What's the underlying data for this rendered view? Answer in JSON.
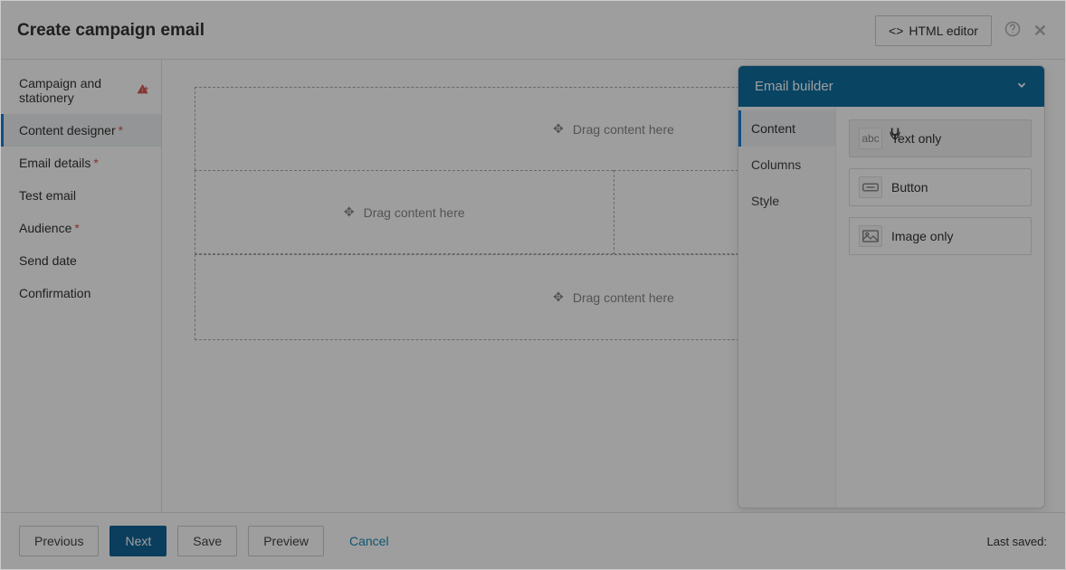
{
  "header": {
    "title": "Create campaign email",
    "html_editor_label": "HTML editor"
  },
  "sidebar": {
    "items": [
      {
        "label": "Campaign and stationery",
        "required": true,
        "warning": true,
        "active": false
      },
      {
        "label": "Content designer",
        "required": true,
        "warning": false,
        "active": true
      },
      {
        "label": "Email details",
        "required": true,
        "warning": false,
        "active": false
      },
      {
        "label": "Test email",
        "required": false,
        "warning": false,
        "active": false
      },
      {
        "label": "Audience",
        "required": true,
        "warning": false,
        "active": false
      },
      {
        "label": "Send date",
        "required": false,
        "warning": false,
        "active": false
      },
      {
        "label": "Confirmation",
        "required": false,
        "warning": false,
        "active": false
      }
    ]
  },
  "canvas": {
    "drop_label": "Drag content here"
  },
  "builder": {
    "title": "Email builder",
    "tabs": [
      {
        "label": "Content",
        "active": true
      },
      {
        "label": "Columns",
        "active": false
      },
      {
        "label": "Style",
        "active": false
      }
    ],
    "items": [
      {
        "label": "Text only",
        "icon": "abc",
        "hover": true
      },
      {
        "label": "Button",
        "icon": "button",
        "hover": false
      },
      {
        "label": "Image only",
        "icon": "image",
        "hover": false
      }
    ]
  },
  "footer": {
    "previous": "Previous",
    "next": "Next",
    "save": "Save",
    "preview": "Preview",
    "cancel": "Cancel",
    "last_saved_label": "Last saved:",
    "last_saved_value": ""
  }
}
